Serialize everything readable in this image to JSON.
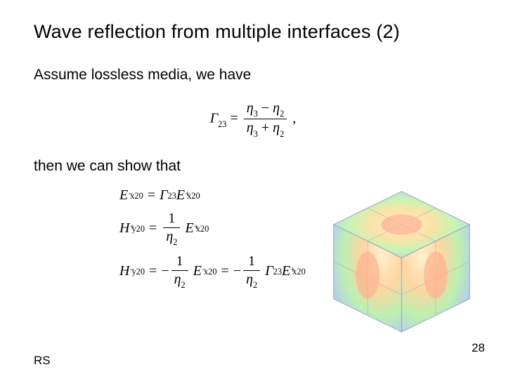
{
  "title": "Wave reflection from multiple interfaces (2)",
  "line1": "Assume lossless media, we have",
  "line2": "then we can show that",
  "eq1": {
    "lhs": "Γ",
    "lhs_sub": "23",
    "num_a": "η",
    "num_a_sub": "3",
    "num_op": "−",
    "num_b": "η",
    "num_b_sub": "2",
    "den_a": "η",
    "den_a_sub": "3",
    "den_op": "+",
    "den_b": "η",
    "den_b_sub": "2",
    "trail": ","
  },
  "eq2a": {
    "E": "E",
    "x20": "x20",
    "minus": "−",
    "eq": "=",
    "G": "Γ",
    "g23": "23",
    "plus": "+"
  },
  "eq2b": {
    "H": "H",
    "y20": "y20",
    "plus": "+",
    "eq": "=",
    "one": "1",
    "eta": "η",
    "eta2": "2",
    "E": "E",
    "x20": "x20"
  },
  "eq2c": {
    "H": "H",
    "y20": "y20",
    "minus": "−",
    "eq": "=",
    "neg": "−",
    "one": "1",
    "eta": "η",
    "eta2": "2",
    "E": "E",
    "x20": "x20",
    "G": "Γ",
    "g23": "23",
    "plus": "+"
  },
  "footer_left": "RS",
  "page_number": "28"
}
